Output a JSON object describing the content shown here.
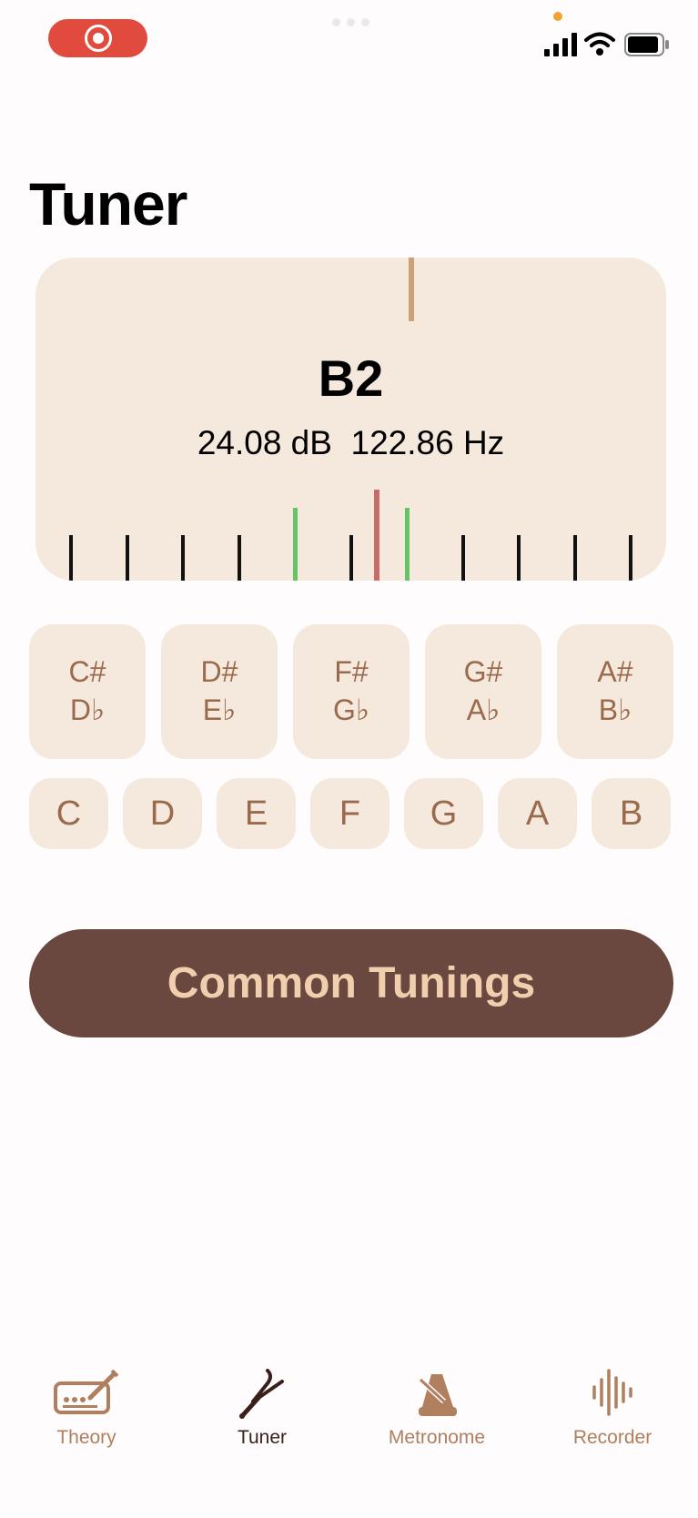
{
  "status_bar": {
    "recording_indicator": "record-icon",
    "icons": [
      "signal-icon",
      "wifi-icon",
      "battery-icon"
    ]
  },
  "page_title": "Tuner",
  "tuner": {
    "note": "B2",
    "readout": "24.08 dB  122.86 Hz",
    "needle_color": "#c96b68",
    "in_tune_color": "#63c566"
  },
  "accidentals": [
    {
      "sharp": "C#",
      "flat": "D♭"
    },
    {
      "sharp": "D#",
      "flat": "E♭"
    },
    {
      "sharp": "F#",
      "flat": "G♭"
    },
    {
      "sharp": "G#",
      "flat": "A♭"
    },
    {
      "sharp": "A#",
      "flat": "B♭"
    }
  ],
  "naturals": [
    "C",
    "D",
    "E",
    "F",
    "G",
    "A",
    "B"
  ],
  "common_tunings_label": "Common Tunings",
  "tabs": [
    {
      "label": "Theory",
      "icon": "keyboard-pencil-icon"
    },
    {
      "label": "Tuner",
      "icon": "tuning-fork-icon",
      "active": true
    },
    {
      "label": "Metronome",
      "icon": "metronome-icon"
    },
    {
      "label": "Recorder",
      "icon": "waveform-icon"
    }
  ],
  "colors": {
    "accent": "#6a483f",
    "card": "#f5e8dd",
    "note_text": "#9a6a4d",
    "button_text": "#f1cfae",
    "tab_inactive": "#b07f5e",
    "tab_active": "#3a1f1a"
  }
}
